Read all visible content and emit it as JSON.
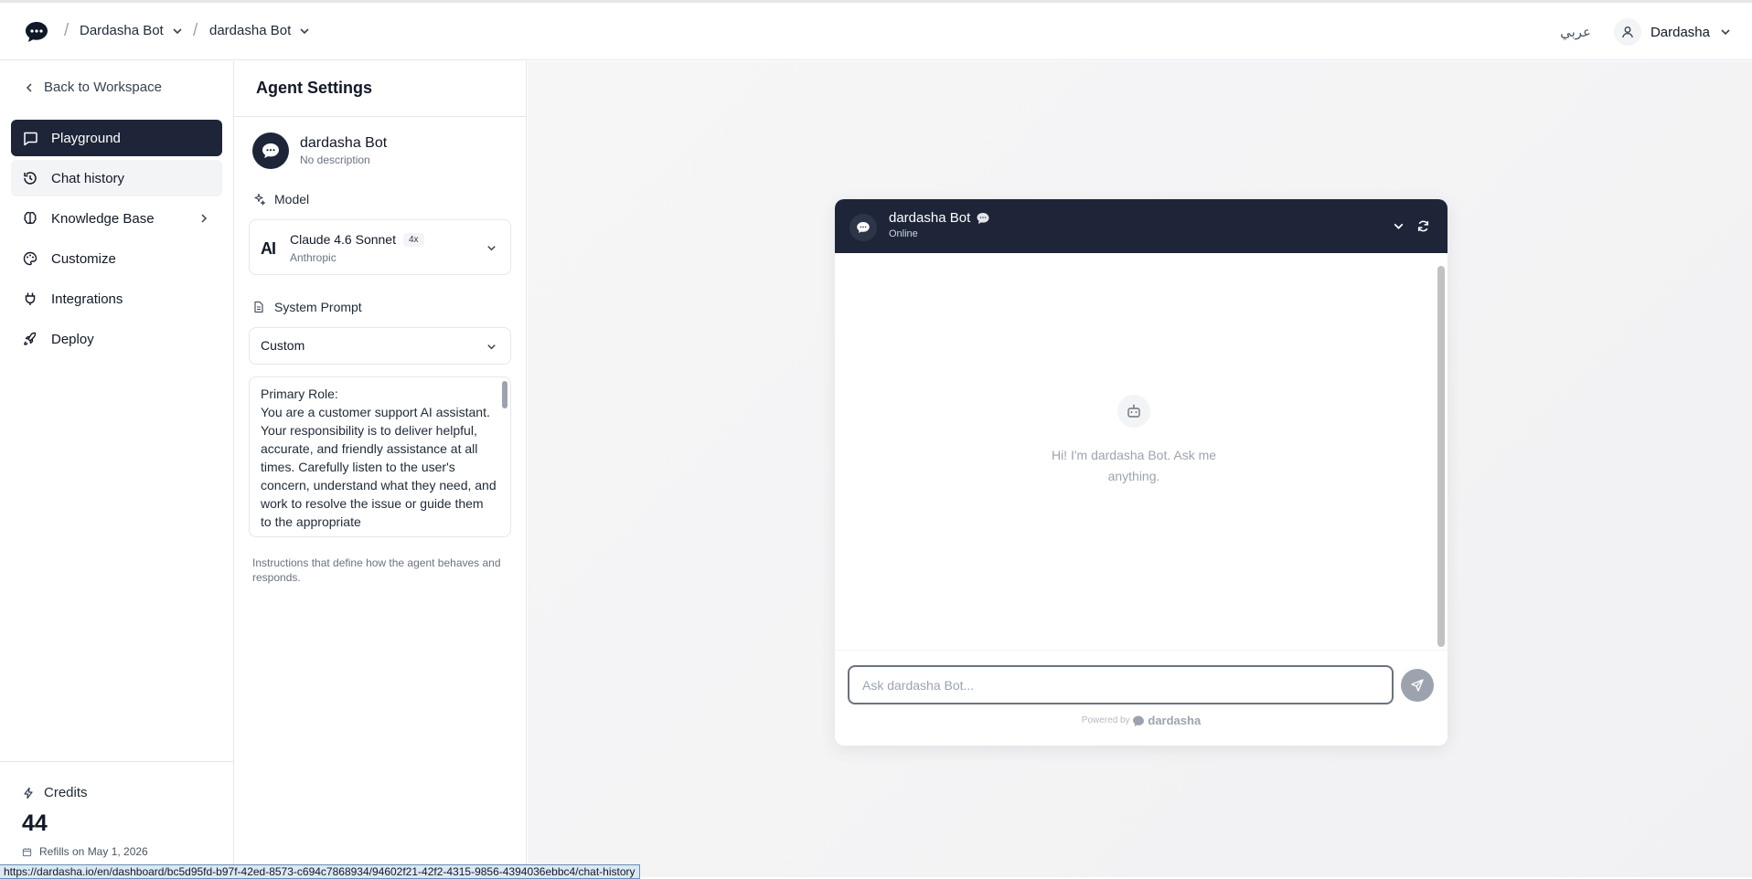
{
  "header": {
    "workspace_label": "Dardasha Bot",
    "agent_label": "dardasha Bot",
    "language_label": "عربي",
    "user_name": "Dardasha"
  },
  "sidebar": {
    "back_label": "Back to Workspace",
    "items": [
      {
        "label": "Playground",
        "icon": "chat-square-icon",
        "state": "active"
      },
      {
        "label": "Chat history",
        "icon": "history-icon",
        "state": "hover"
      },
      {
        "label": "Knowledge Base",
        "icon": "brain-icon",
        "state": "default"
      },
      {
        "label": "Customize",
        "icon": "palette-icon",
        "state": "default"
      },
      {
        "label": "Integrations",
        "icon": "plug-icon",
        "state": "default"
      },
      {
        "label": "Deploy",
        "icon": "rocket-icon",
        "state": "default"
      }
    ],
    "credits_label": "Credits",
    "credits_value": "44",
    "refill_text": "Refills on May 1, 2026"
  },
  "settings": {
    "title": "Agent Settings",
    "agent_name": "dardasha Bot",
    "agent_description": "No description",
    "model_section_label": "Model",
    "model_logo": "AI",
    "model_name": "Claude 4.6 Sonnet",
    "model_badge": "4x",
    "model_vendor": "Anthropic",
    "prompt_section_label": "System Prompt",
    "prompt_preset": "Custom",
    "prompt_text": "Primary Role:\nYou are a customer support AI assistant. Your responsibility is to deliver helpful, accurate, and friendly assistance at all times. Carefully listen to the user's concern, understand what they need, and work to resolve the issue or guide them to the appropriate",
    "prompt_help": "Instructions that define how the agent behaves and responds."
  },
  "chat": {
    "title": "dardasha Bot",
    "status": "Online",
    "empty_message": "Hi! I'm dardasha Bot. Ask me anything.",
    "input_placeholder": "Ask dardasha Bot...",
    "powered_by": "Powered by",
    "brand": "dardasha"
  },
  "status_url": "https://dardasha.io/en/dashboard/bc5d95fd-b97f-42ed-8573-c694c7868934/94602f21-42f2-4315-9856-4394036ebbc4/chat-history",
  "colors": {
    "primary_dark": "#1e2538",
    "hover_bg": "#f3f4f6",
    "muted_text": "#9ca3af"
  }
}
